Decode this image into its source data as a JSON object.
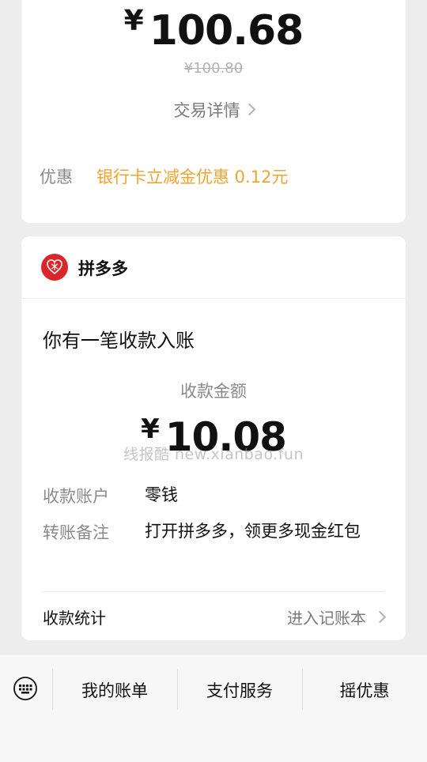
{
  "payment": {
    "currency": "¥",
    "amount": "100.68",
    "original_amount": "¥100.80",
    "trade_details_label": "交易详情",
    "discount_label": "优惠",
    "discount_value": "银行卡立减金优惠 0.12元"
  },
  "message": {
    "merchant": "拼多多",
    "headline": "你有一笔收款入账",
    "amount_label": "收款金额",
    "currency": "¥",
    "amount": "10.08",
    "watermark": "线报酷 new.xianbao.fun",
    "account_label": "收款账户",
    "account_value": "零钱",
    "note_label": "转账备注",
    "note_value": "打开拼多多，领更多现金红包",
    "stats_label": "收款统计",
    "ledger_link": "进入记账本"
  },
  "bottom_menu": {
    "items": [
      "我的账单",
      "支付服务",
      "摇优惠"
    ]
  },
  "colors": {
    "discount": "#f0a330",
    "brand_red": "#d8262b",
    "background": "#ededed"
  },
  "icons": {
    "keyboard": "keyboard-icon",
    "chevron": "chevron-right-icon",
    "logo": "pinduoduo-logo-icon"
  }
}
